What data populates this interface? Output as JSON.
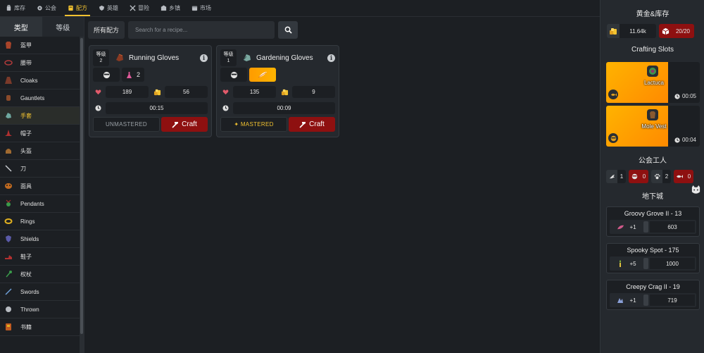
{
  "topnav": {
    "tabs": [
      {
        "label": "库存",
        "icon": "backpack-icon"
      },
      {
        "label": "公会",
        "icon": "gear-icon"
      },
      {
        "label": "配方",
        "icon": "book-icon",
        "active": true
      },
      {
        "label": "英雄",
        "icon": "shield-icon"
      },
      {
        "label": "冒险",
        "icon": "crossed-swords-icon"
      },
      {
        "label": "乡镇",
        "icon": "building-icon"
      },
      {
        "label": "市场",
        "icon": "store-icon"
      }
    ]
  },
  "sidebar": {
    "tabs": [
      {
        "label": "类型",
        "active": true
      },
      {
        "label": "等级",
        "active": false
      }
    ],
    "items": [
      {
        "label": "盔甲",
        "icon": "armor-icon"
      },
      {
        "label": "腰带",
        "icon": "belt-icon"
      },
      {
        "label": "Cloaks",
        "icon": "cloak-icon"
      },
      {
        "label": "Gauntlets",
        "icon": "gauntlet-icon"
      },
      {
        "label": "手套",
        "icon": "glove-icon",
        "active": true
      },
      {
        "label": "帽子",
        "icon": "hat-icon"
      },
      {
        "label": "头盔",
        "icon": "helmet-icon"
      },
      {
        "label": "刀",
        "icon": "knife-icon"
      },
      {
        "label": "面具",
        "icon": "mask-icon"
      },
      {
        "label": "Pendants",
        "icon": "pendant-icon"
      },
      {
        "label": "Rings",
        "icon": "ring-icon"
      },
      {
        "label": "Shields",
        "icon": "shield-icon"
      },
      {
        "label": "鞋子",
        "icon": "shoe-icon"
      },
      {
        "label": "权杖",
        "icon": "scepter-icon"
      },
      {
        "label": "Swords",
        "icon": "sword-icon"
      },
      {
        "label": "Thrown",
        "icon": "thrown-icon"
      },
      {
        "label": "书籍",
        "icon": "tome-icon"
      }
    ]
  },
  "main": {
    "all_label": "所有配方",
    "search_placeholder": "Search for a recipe...",
    "cards": [
      {
        "level_label": "等级",
        "level": "2",
        "title": "Running Gloves",
        "icon": "running-gloves-icon",
        "requirements": [
          {
            "icon": "worker-face-icon",
            "value": ""
          },
          {
            "icon": "potion-icon",
            "value": "2"
          }
        ],
        "stats": {
          "health": "189",
          "gold": "56",
          "time": "00:15"
        },
        "mastery": "UNMASTERED",
        "craft_label": "Craft"
      },
      {
        "level_label": "等级",
        "level": "1",
        "title": "Gardening Gloves",
        "icon": "gardening-gloves-icon",
        "requirements": [
          {
            "icon": "worker-face-icon",
            "value": ""
          },
          {
            "icon": "feather-icon",
            "value": ""
          }
        ],
        "stats": {
          "health": "135",
          "gold": "9",
          "time": "00:09"
        },
        "mastery": "✦ MASTERED",
        "craft_label": "Craft"
      }
    ]
  },
  "rightpanel": {
    "gold_title": "黄金&库存",
    "gold": "11.64k",
    "inventory": "20/20",
    "slots_title": "Crafting Slots",
    "slots": [
      {
        "name": "Lactuca",
        "icon": "lactuca-icon",
        "time": "00:05"
      },
      {
        "name": "Mole Vest",
        "icon": "mole-vest-icon",
        "time": "00:04"
      }
    ],
    "workers_title": "公会工人",
    "workers": [
      {
        "icon": "bird-icon",
        "value": "1",
        "red": false
      },
      {
        "icon": "face-icon",
        "value": "0",
        "red": true
      },
      {
        "icon": "paw-icon",
        "value": "2",
        "red": false
      },
      {
        "icon": "fish-icon",
        "value": "0",
        "red": true
      }
    ],
    "dungeon_title": "地下城",
    "dungeons": [
      {
        "name": "Groovy Grove II - 13",
        "bonus": "+1",
        "icon": "leaf-icon",
        "value": "603"
      },
      {
        "name": "Spooky Spot - 175",
        "bonus": "+5",
        "icon": "candle-icon",
        "value": "1000"
      },
      {
        "name": "Creepy Crag II - 19",
        "bonus": "+1",
        "icon": "crystal-icon",
        "value": "719"
      }
    ]
  },
  "colors": {
    "accent": "#f2c230",
    "craft": "#8e1010",
    "slot_fill": "#ff9b00"
  }
}
